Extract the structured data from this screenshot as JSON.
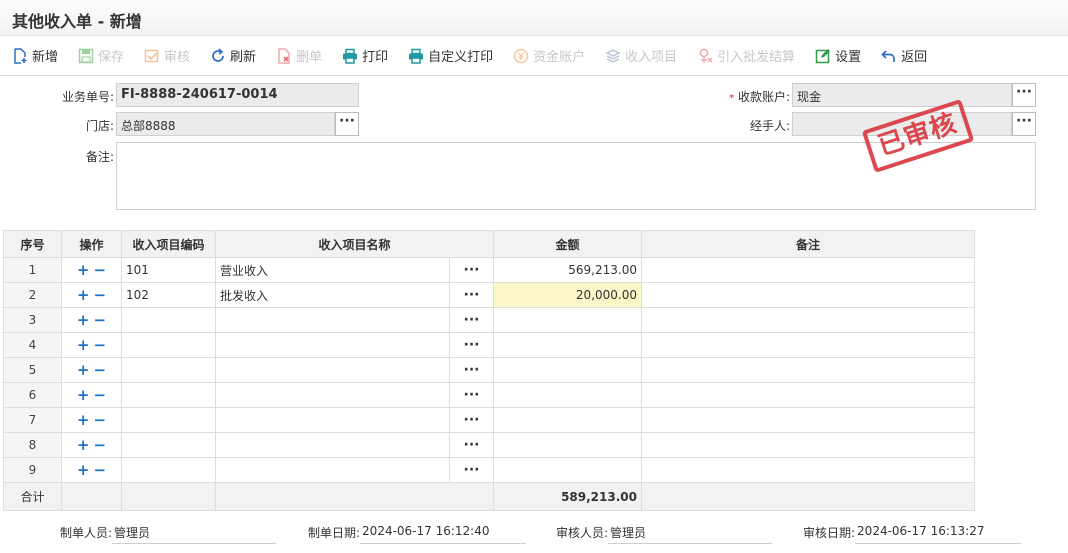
{
  "page": {
    "title": "其他收入单 - 新增"
  },
  "toolbar": {
    "new": "新增",
    "save": "保存",
    "audit": "审核",
    "refresh": "刷新",
    "delete": "删单",
    "print": "打印",
    "custom_print": "自定义打印",
    "fund_account": "资金账户",
    "income_item": "收入项目",
    "import_wholesale": "引入批发结算",
    "settings": "设置",
    "back": "返回"
  },
  "form": {
    "doc_no_label": "业务单号:",
    "doc_no": "FI-8888-240617-0014",
    "store_label": "门店:",
    "store": "总部8888",
    "remark_label": "备注:",
    "remark": "",
    "account_req": "*",
    "account_label": "收款账户:",
    "account": "现金",
    "handler_label": "经手人:",
    "handler": ""
  },
  "stamp": "已审核",
  "grid": {
    "headers": [
      "序号",
      "操作",
      "收入项目编码",
      "收入项目名称",
      "金额",
      "备注"
    ],
    "rows": [
      {
        "seq": "1",
        "code": "101",
        "name": "营业收入",
        "amount": "569,213.00",
        "remark": ""
      },
      {
        "seq": "2",
        "code": "102",
        "name": "批发收入",
        "amount": "20,000.00",
        "remark": ""
      },
      {
        "seq": "3",
        "code": "",
        "name": "",
        "amount": "",
        "remark": ""
      },
      {
        "seq": "4",
        "code": "",
        "name": "",
        "amount": "",
        "remark": ""
      },
      {
        "seq": "5",
        "code": "",
        "name": "",
        "amount": "",
        "remark": ""
      },
      {
        "seq": "6",
        "code": "",
        "name": "",
        "amount": "",
        "remark": ""
      },
      {
        "seq": "7",
        "code": "",
        "name": "",
        "amount": "",
        "remark": ""
      },
      {
        "seq": "8",
        "code": "",
        "name": "",
        "amount": "",
        "remark": ""
      },
      {
        "seq": "9",
        "code": "",
        "name": "",
        "amount": "",
        "remark": ""
      }
    ],
    "total_label": "合计",
    "total_amount": "589,213.00",
    "op_add": "+",
    "op_remove": "−",
    "ellipsis": "···"
  },
  "footer": {
    "creator_label": "制单人员:",
    "creator": "管理员",
    "created_label": "制单日期:",
    "created": "2024-06-17 16:12:40",
    "auditor_label": "审核人员:",
    "auditor": "管理员",
    "audited_label": "审核日期:",
    "audited": "2024-06-17 16:13:27"
  },
  "colors": {
    "accent": "#1a74c9",
    "stamp": "#d9363e",
    "highlight": "#fbf6c8"
  }
}
